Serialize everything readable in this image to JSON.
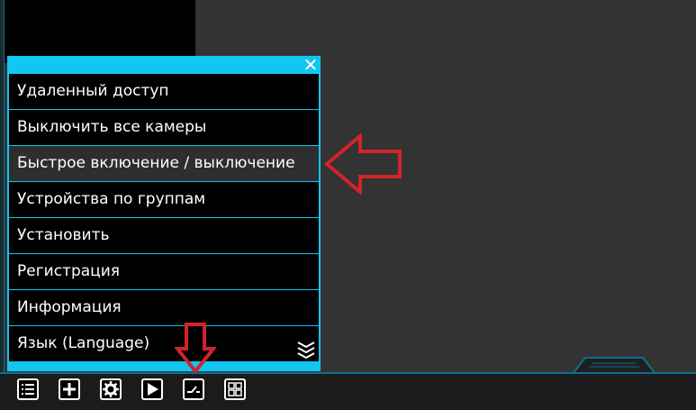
{
  "menu": {
    "close_glyph": "✕",
    "items": [
      {
        "label": "Удаленный доступ"
      },
      {
        "label": "Выключить все камеры"
      },
      {
        "label": "Быстрое включение / выключение"
      },
      {
        "label": "Устройства по группам"
      },
      {
        "label": "Установить"
      },
      {
        "label": "Регистрация"
      },
      {
        "label": "Информация"
      },
      {
        "label": "Язык (Language)"
      }
    ],
    "highlighted_index": 2,
    "more_icon": "chevrons-down-icon"
  },
  "toolbar": {
    "buttons": [
      {
        "icon": "menu-list-icon"
      },
      {
        "icon": "plus-icon"
      },
      {
        "icon": "gear-icon"
      },
      {
        "icon": "play-icon"
      },
      {
        "icon": "switch-icon"
      },
      {
        "icon": "grid-icon"
      }
    ]
  },
  "colors": {
    "accent": "#12c6f2",
    "annotation_red": "#d2232a",
    "background": "#333333"
  }
}
